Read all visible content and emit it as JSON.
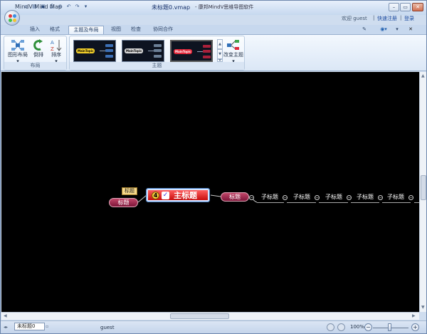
{
  "window": {
    "app_title": "MindV Mind Map",
    "document_title": "未标题0.vmap",
    "document_subtitle": "- 康邦MindV思维导图软件",
    "minimize": "–",
    "restore": "▭",
    "close": "✕"
  },
  "quick_access": [
    "new-icon",
    "open-icon",
    "save-icon",
    "print-icon",
    "help-circle-icon",
    "undo-icon",
    "redo-icon",
    "customize-icon"
  ],
  "header_right": {
    "welcome": "欢迎 guest",
    "quick_register": "快速注册",
    "login": "登录",
    "sep": "|"
  },
  "tabs": [
    {
      "label": "插入",
      "active": false
    },
    {
      "label": "格式",
      "active": false
    },
    {
      "label": "主题及布局",
      "active": true
    },
    {
      "label": "视图",
      "active": false
    },
    {
      "label": "检查",
      "active": false
    },
    {
      "label": "协同合作",
      "active": false
    }
  ],
  "ribbon": {
    "layout_group": {
      "caption": "布局",
      "buttons": [
        {
          "label": "图形布局",
          "icon": "layout-icon"
        },
        {
          "label": "倒排",
          "icon": "reverse-icon"
        },
        {
          "label": "排序",
          "icon": "sort-icon"
        }
      ]
    },
    "theme_group": {
      "caption": "主题",
      "thumbnails": [
        {
          "pill": "MainTopic",
          "bg": "#0b1a3a",
          "pill_color": "#f5d22a"
        },
        {
          "pill": "MainTopic",
          "bg": "#101010",
          "pill_color": "#d9d9d9"
        },
        {
          "pill": "MainTopic",
          "bg": "#0a0a0a",
          "pill_color": "#e0283a"
        }
      ],
      "change_theme": "改变主题"
    }
  },
  "mindmap": {
    "main_topic": {
      "number": "4",
      "check": "✓",
      "label": "主标题"
    },
    "callout": "标题",
    "left_topic": "标题",
    "right_topic": "标题",
    "subtopics": [
      "子标题",
      "子标题",
      "子标题",
      "子标题",
      "子标题"
    ],
    "collapse": "−"
  },
  "status": {
    "sheet_tab": "未标题0",
    "user": "guest",
    "zoom": "100%",
    "zoom_out": "−",
    "zoom_in": "+"
  },
  "colors": {
    "canvas": "#000000",
    "main_topic": "#d91414",
    "topic": "#8a1a42",
    "callout": "#f6d788"
  }
}
